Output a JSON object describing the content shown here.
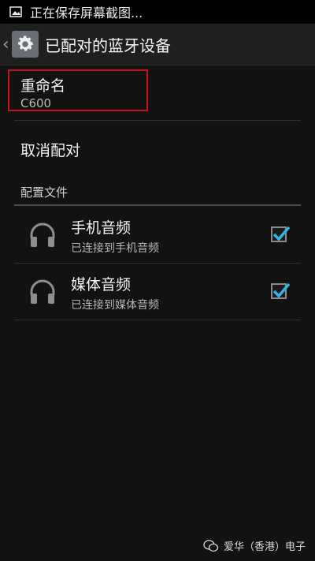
{
  "status_bar": {
    "text": "正在保存屏幕截图..."
  },
  "action_bar": {
    "title": "已配对的蓝牙设备"
  },
  "rename": {
    "label": "重命名",
    "value": "C600"
  },
  "unpair": {
    "label": "取消配对"
  },
  "profiles": {
    "header": "配置文件",
    "items": [
      {
        "title": "手机音频",
        "subtitle": "已连接到手机音频",
        "checked": true
      },
      {
        "title": "媒体音频",
        "subtitle": "已连接到媒体音频",
        "checked": true
      }
    ]
  },
  "watermark": {
    "text": "爱华（香港）电子"
  },
  "colors": {
    "highlight_border": "#c0161c",
    "check_accent": "#33b5e5"
  }
}
